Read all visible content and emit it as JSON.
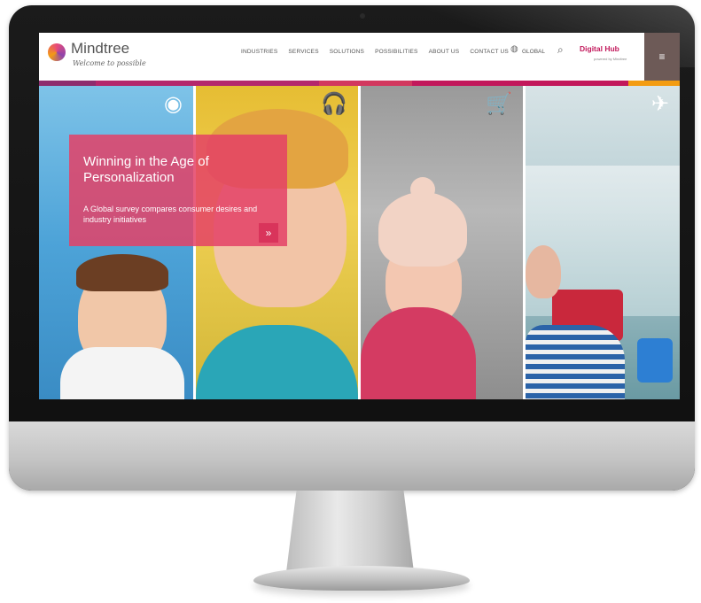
{
  "site": {
    "logo_text": "Mindtree",
    "tagline": "Welcome to possible"
  },
  "nav": {
    "items": [
      "INDUSTRIES",
      "SERVICES",
      "SOLUTIONS",
      "POSSIBILITIES",
      "ABOUT US",
      "CONTACT US"
    ],
    "global_label": "GLOBAL",
    "hub_label": "Digital Hub",
    "hub_sub": "powered by Mindtree",
    "menu_icon": "≡"
  },
  "stripe_colors": [
    "#8e2d6d",
    "#b4286c",
    "#d2385e",
    "#c2185b",
    "#f39c12"
  ],
  "hero": {
    "title": "Winning in the Age of Personalization",
    "subtitle": "A Global survey compares consumer desires and industry initiatives",
    "arrow": "»"
  },
  "panel_icons": {
    "p1": "coins-icon",
    "p2": "headphones-icon",
    "p3": "cart-icon",
    "p4": "plane-icon"
  }
}
